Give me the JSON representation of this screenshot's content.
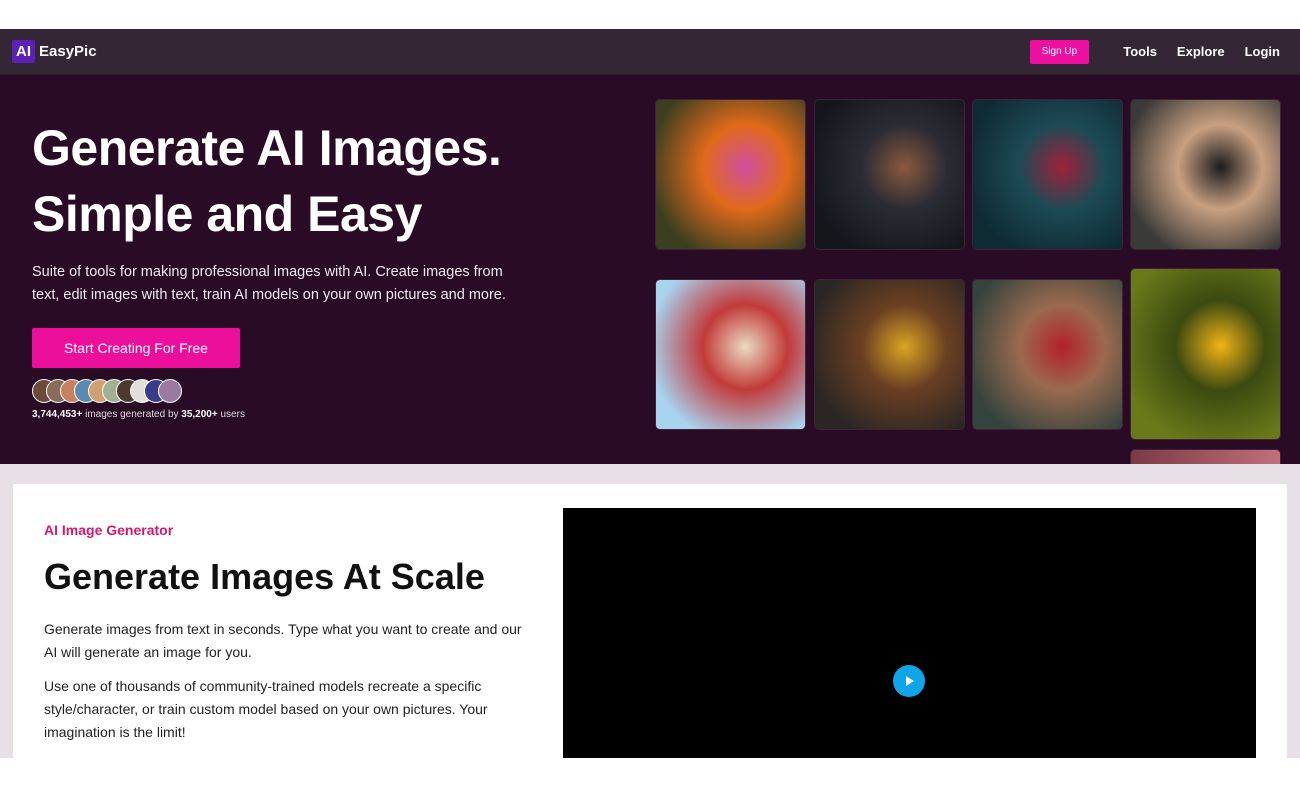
{
  "nav": {
    "logo_badge": "AI",
    "logo_text": "EasyPic",
    "signup_label": "Sign Up",
    "links": [
      "Tools",
      "Explore",
      "Login"
    ]
  },
  "hero": {
    "title_line1": "Generate AI Images.",
    "title_line2": "Simple and Easy",
    "subtitle": "Suite of tools for making professional images with AI. Create images from text, edit images with text, train AI models on your own pictures and more.",
    "cta_label": "Start Creating For Free",
    "images_count": "3,744,453+",
    "images_text": " images generated by ",
    "users_count": "35,200+",
    "users_text": " users"
  },
  "gallery": [
    {
      "name": "butterfly-image",
      "colors": [
        "#3b3f1f",
        "#e06a1a",
        "#d24da0"
      ]
    },
    {
      "name": "woman-night-portrait-image",
      "colors": [
        "#14161c",
        "#2b2b35",
        "#8a5a3c"
      ]
    },
    {
      "name": "neon-city-street-image",
      "colors": [
        "#0e2a33",
        "#1d4a55",
        "#a0203a"
      ]
    },
    {
      "name": "smiling-woman-portrait-image",
      "colors": [
        "#3a3a38",
        "#c9a081",
        "#1c1c1e"
      ]
    },
    {
      "name": "toy-castle-image",
      "colors": [
        "#a8d4f0",
        "#c23a3a",
        "#e8dcc0"
      ]
    },
    {
      "name": "treasure-chest-image",
      "colors": [
        "#2a2624",
        "#6b3f22",
        "#d9a520"
      ]
    },
    {
      "name": "woman-red-dress-image",
      "colors": [
        "#36443e",
        "#9a6a4f",
        "#b2212a"
      ]
    },
    {
      "name": "bee-on-flower-image",
      "colors": [
        "#6a7a1a",
        "#3b4a10",
        "#f2b416"
      ]
    }
  ],
  "section": {
    "eyebrow": "AI Image Generator",
    "title": "Generate Images At Scale",
    "para1": "Generate images from text in seconds. Type what you want to create and our AI will generate an image for you.",
    "para2": "Use one of thousands of community-trained models recreate a specific style/character, or train custom model based on your own pictures. Your imagination is the limit!"
  },
  "colors": {
    "accent": "#ec0f9c",
    "hero_bg": "#2a0b25",
    "nav_bg": "#342634",
    "eyebrow": "#d6176e",
    "play_button": "#0ea5e9"
  }
}
